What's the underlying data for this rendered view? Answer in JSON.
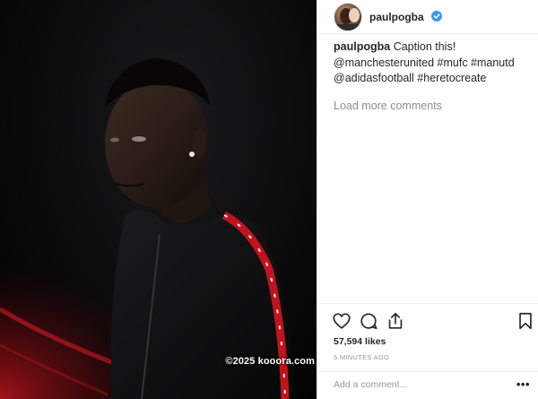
{
  "post": {
    "image_alt": "Man in a black track jacket with red trim against a dark background",
    "watermark": "©2025 kooora.com"
  },
  "header": {
    "username": "paulpogba",
    "avatar_icon": "avatar-photo",
    "verified_icon": "verified-badge-icon",
    "verified_color": "#3897f0"
  },
  "caption": {
    "username": "paulpogba",
    "text": "Caption this!",
    "tags_line1": "@manchesterunited #mufc #manutd",
    "tags_line2": "@adidasfootball #heretocreate"
  },
  "comments": {
    "load_more_label": "Load more comments"
  },
  "actions": {
    "like_icon": "heart-icon",
    "comment_icon": "comment-icon",
    "share_icon": "share-icon",
    "save_icon": "bookmark-icon",
    "likes_text": "57,594 likes",
    "timestamp": "5 MINUTES AGO"
  },
  "comment_bar": {
    "placeholder": "Add a comment...",
    "more_label": "•••"
  }
}
